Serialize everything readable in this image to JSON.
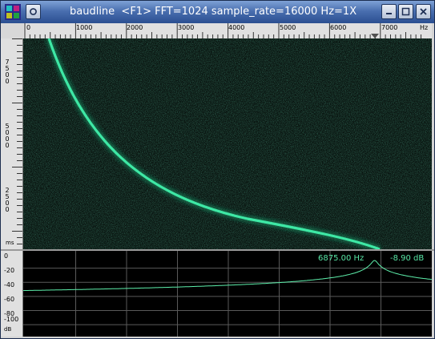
{
  "window": {
    "title": "baudline  <F1> FFT=1024 sample_rate=16000 Hz=1X",
    "icons": [
      "app-icon",
      "window-menu-icon",
      "minimize-icon",
      "maximize-icon",
      "close-icon"
    ]
  },
  "freq_ruler": {
    "ticks": [
      "0",
      "1000",
      "2000",
      "3000",
      "4000",
      "5000",
      "6000",
      "7000"
    ],
    "unit": "Hz",
    "cursor": "cursor-marker-icon"
  },
  "time_ruler": {
    "labels": [
      [
        "7",
        "5",
        "0",
        "0"
      ],
      [
        "5",
        "0",
        "0",
        "0"
      ],
      [
        "2",
        "5",
        "0",
        "0"
      ]
    ],
    "unit": "ms"
  },
  "spectrum": {
    "db_ticks": [
      "0",
      "-20",
      "-40",
      "-60",
      "-80",
      "-100"
    ],
    "db_unit": "dB",
    "readout_freq": "6875.00 Hz",
    "readout_db": "-8.90 dB",
    "line_color": "#5ef0ac"
  },
  "chart_data": {
    "type": "line",
    "xlabel": "Hz",
    "ylabel": "dB",
    "xlim": [
      0,
      8000
    ],
    "ylim": [
      -110,
      0
    ],
    "peak": {
      "x": 6875,
      "y": -8.9
    },
    "noise_floor": -104
  }
}
